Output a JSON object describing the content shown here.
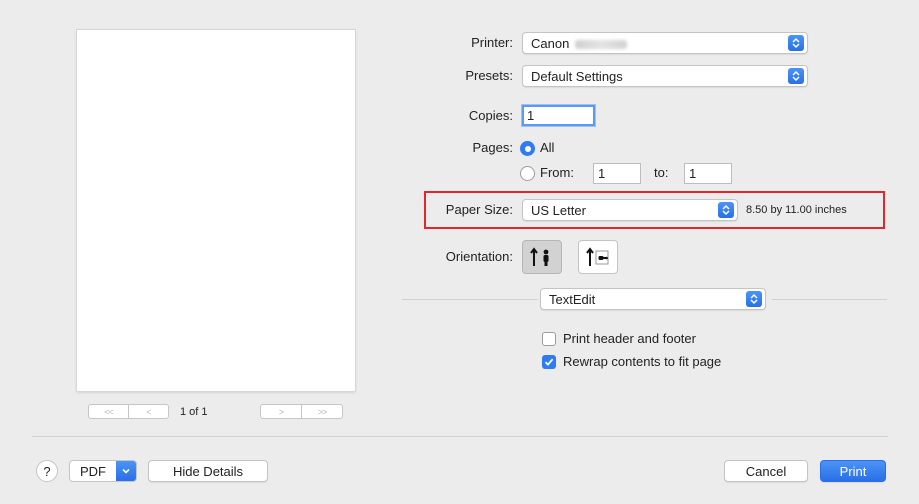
{
  "preview": {
    "first_label": "<<",
    "prev_label": "<",
    "page_count": "1 of 1",
    "next_label": ">",
    "last_label": ">>"
  },
  "printer": {
    "label": "Printer:",
    "value": "Canon"
  },
  "presets": {
    "label": "Presets:",
    "value": "Default Settings"
  },
  "copies": {
    "label": "Copies:",
    "value": "1"
  },
  "pages": {
    "label": "Pages:",
    "all_label": "All",
    "all_selected": true,
    "from_label": "From:",
    "from_value": "1",
    "to_label": "to:",
    "to_value": "1"
  },
  "paper_size": {
    "label": "Paper Size:",
    "value": "US Letter",
    "dimensions": "8.50 by 11.00 inches"
  },
  "orientation": {
    "label": "Orientation:",
    "selected": "portrait"
  },
  "app_section": {
    "value": "TextEdit"
  },
  "options": [
    {
      "label": "Print header and footer",
      "checked": false
    },
    {
      "label": "Rewrap contents to fit page",
      "checked": true
    }
  ],
  "footer": {
    "help_label": "?",
    "pdf_label": "PDF",
    "hide_details_label": "Hide Details",
    "cancel_label": "Cancel",
    "print_label": "Print"
  },
  "colors": {
    "accent": "#2f7cf0",
    "highlight": "#e3262c",
    "background": "#ececec"
  }
}
